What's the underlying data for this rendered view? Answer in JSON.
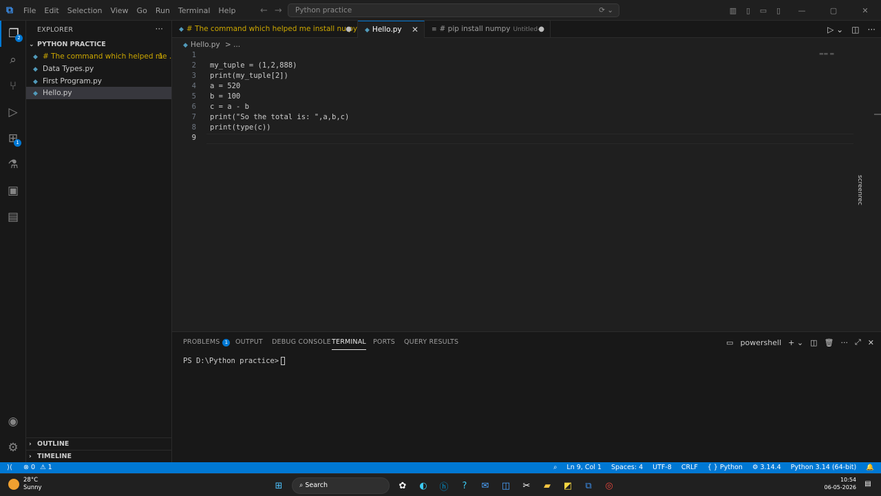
{
  "menu": [
    "File",
    "Edit",
    "Selection",
    "View",
    "Go",
    "Run",
    "Terminal",
    "Help"
  ],
  "command_center": "Python practice",
  "activity": {
    "explorer_badge": "2",
    "extensions_badge": "1"
  },
  "sidebar": {
    "title": "EXPLORER",
    "folder": "PYTHON PRACTICE",
    "files": [
      {
        "name": "# The command which helped me ...",
        "count": "1"
      },
      {
        "name": "Data Types.py"
      },
      {
        "name": "First Program.py"
      },
      {
        "name": "Hello.py"
      }
    ],
    "outline": "OUTLINE",
    "timeline": "TIMELINE"
  },
  "tabs": [
    {
      "label": "# The command which helped me install nu.py",
      "count": "1"
    },
    {
      "label": "Hello.py"
    },
    {
      "label": "# pip install numpy",
      "sub": "Untitled-1"
    }
  ],
  "breadcrumb": {
    "file": "Hello.py",
    "rest": "> ..."
  },
  "code": {
    "lines": [
      "",
      "my_tuple = (1,2,888)",
      "print(my_tuple[2])",
      "a = 520",
      "b = 100",
      "c = a - b",
      "print(\"So the total is: \",a,b,c)",
      "print(type(c))",
      ""
    ],
    "numbers": [
      "1",
      "2",
      "3",
      "4",
      "5",
      "6",
      "7",
      "8",
      "9"
    ]
  },
  "watermark": "screenrec",
  "panel": {
    "tabs": [
      "PROBLEMS",
      "OUTPUT",
      "DEBUG CONSOLE",
      "TERMINAL",
      "PORTS",
      "QUERY RESULTS"
    ],
    "problems_badge": "1",
    "shell": "powershell",
    "prompt": "PS D:\\Python practice>"
  },
  "status": {
    "errors": "0",
    "warnings": "1",
    "position": "Ln 9, Col 1",
    "spaces": "Spaces: 4",
    "encoding": "UTF-8",
    "eol": "CRLF",
    "language": "Python",
    "version": "3.14.4",
    "interpreter": "Python 3.14 (64-bit)"
  },
  "taskbar": {
    "temp": "28°C",
    "weather": "Sunny",
    "search": "Search",
    "time": "10:54",
    "date": "06-05-2026"
  },
  "colors": {
    "accent": "#0078d4",
    "warning": "#cca700",
    "python_icon": "#519aba"
  }
}
